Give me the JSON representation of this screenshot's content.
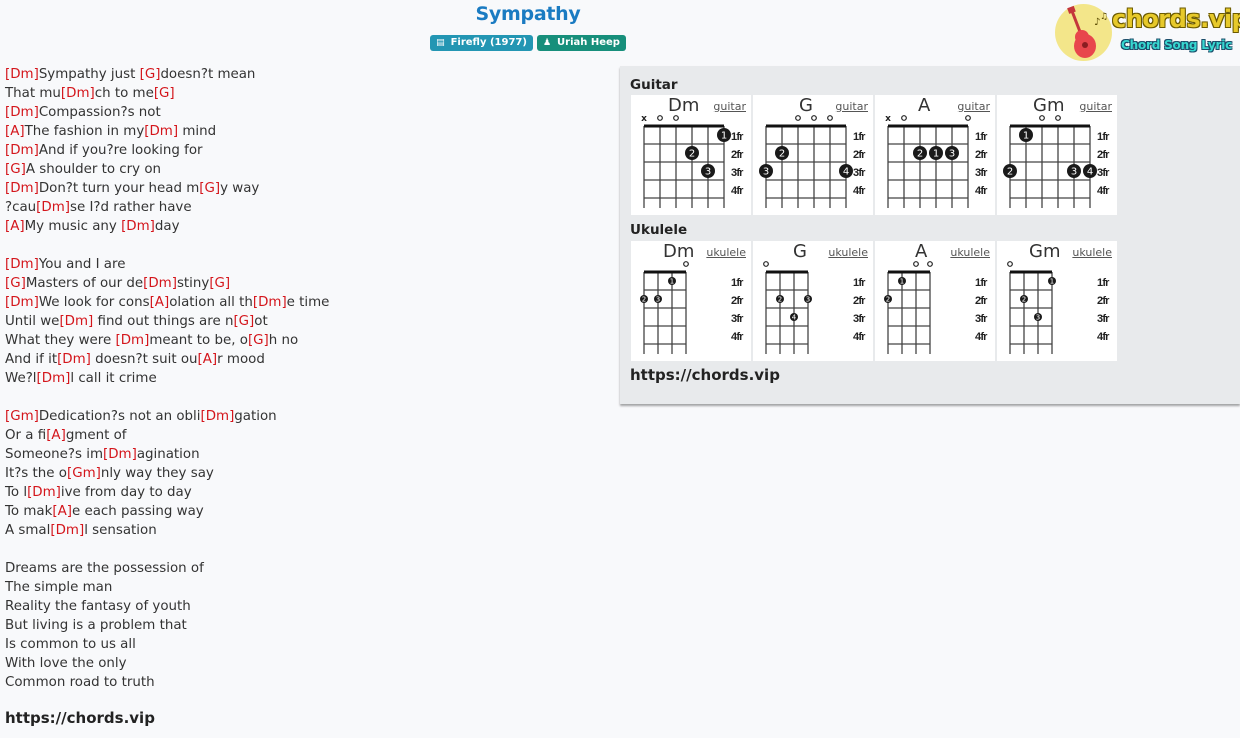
{
  "song": {
    "title": "Sympathy",
    "album": "Firefly (1977)",
    "album_icon": "book-icon",
    "artist": "Uriah Heep",
    "artist_icon": "user-icon"
  },
  "logo": {
    "name": "chords.vip",
    "tagline": "Chord Song Lyric",
    "icon": "guitar-icon"
  },
  "colors": {
    "title": "#1a7bc2",
    "chord": "#d4151b",
    "album_tag": "#2396b3",
    "artist_tag": "#178f7b"
  },
  "lyrics": [
    [
      {
        "c": "Dm"
      },
      {
        "t": "Sympathy just "
      },
      {
        "c": "G"
      },
      {
        "t": "doesn?t mean"
      }
    ],
    [
      {
        "t": "That mu"
      },
      {
        "c": "Dm"
      },
      {
        "t": "ch to me"
      },
      {
        "c": "G"
      }
    ],
    [
      {
        "c": "Dm"
      },
      {
        "t": "Compassion?s not"
      }
    ],
    [
      {
        "c": "A"
      },
      {
        "t": "The fashion in my"
      },
      {
        "c": "Dm"
      },
      {
        "t": " mind"
      }
    ],
    [
      {
        "c": "Dm"
      },
      {
        "t": "And if you?re looking for"
      }
    ],
    [
      {
        "c": "G"
      },
      {
        "t": "A shoulder to cry on"
      }
    ],
    [
      {
        "c": "Dm"
      },
      {
        "t": "Don?t turn your head m"
      },
      {
        "c": "G"
      },
      {
        "t": "y way"
      }
    ],
    [
      {
        "t": "?cau"
      },
      {
        "c": "Dm"
      },
      {
        "t": "se I?d rather have"
      }
    ],
    [
      {
        "c": "A"
      },
      {
        "t": "My music any "
      },
      {
        "c": "Dm"
      },
      {
        "t": "day"
      }
    ],
    [],
    [
      {
        "c": "Dm"
      },
      {
        "t": "You and I are"
      }
    ],
    [
      {
        "c": "G"
      },
      {
        "t": "Masters of our de"
      },
      {
        "c": "Dm"
      },
      {
        "t": "stiny"
      },
      {
        "c": "G"
      }
    ],
    [
      {
        "c": "Dm"
      },
      {
        "t": "We look for cons"
      },
      {
        "c": "A"
      },
      {
        "t": "olation all th"
      },
      {
        "c": "Dm"
      },
      {
        "t": "e time"
      }
    ],
    [
      {
        "t": "Until we"
      },
      {
        "c": "Dm"
      },
      {
        "t": " find out things are n"
      },
      {
        "c": "G"
      },
      {
        "t": "ot"
      }
    ],
    [
      {
        "t": "What they were "
      },
      {
        "c": "Dm"
      },
      {
        "t": "meant to be, o"
      },
      {
        "c": "G"
      },
      {
        "t": "h no"
      }
    ],
    [
      {
        "t": "And if it"
      },
      {
        "c": "Dm"
      },
      {
        "t": " doesn?t suit ou"
      },
      {
        "c": "A"
      },
      {
        "t": "r mood"
      }
    ],
    [
      {
        "t": "We?l"
      },
      {
        "c": "Dm"
      },
      {
        "t": "l call it crime"
      }
    ],
    [],
    [
      {
        "c": "Gm"
      },
      {
        "t": "Dedication?s not an obli"
      },
      {
        "c": "Dm"
      },
      {
        "t": "gation"
      }
    ],
    [
      {
        "t": "Or a fi"
      },
      {
        "c": "A"
      },
      {
        "t": "gment of"
      }
    ],
    [
      {
        "t": "Someone?s im"
      },
      {
        "c": "Dm"
      },
      {
        "t": "agination"
      }
    ],
    [
      {
        "t": "It?s the o"
      },
      {
        "c": "Gm"
      },
      {
        "t": "nly way they say"
      }
    ],
    [
      {
        "t": "To l"
      },
      {
        "c": "Dm"
      },
      {
        "t": "ive from day to day"
      }
    ],
    [
      {
        "t": "To mak"
      },
      {
        "c": "A"
      },
      {
        "t": "e each passing way"
      }
    ],
    [
      {
        "t": "A smal"
      },
      {
        "c": "Dm"
      },
      {
        "t": "l sensation"
      }
    ],
    [],
    [
      {
        "t": "Dreams are the possession of"
      }
    ],
    [
      {
        "t": "The simple man"
      }
    ],
    [
      {
        "t": "Reality the fantasy of youth"
      }
    ],
    [
      {
        "t": "But living is a problem that"
      }
    ],
    [
      {
        "t": "Is common to us all"
      }
    ],
    [
      {
        "t": "With love the only"
      }
    ],
    [
      {
        "t": "Common road to truth"
      }
    ]
  ],
  "footer_url": "https://chords.vip",
  "chord_panel": {
    "url": "https://chords.vip",
    "fret_labels": [
      "1fr",
      "2fr",
      "3fr",
      "4fr"
    ],
    "guitar": {
      "heading": "Guitar",
      "link_label": "guitar",
      "chords": [
        {
          "name": "Dm",
          "markers": [
            "x",
            "o",
            "o",
            "",
            "",
            ""
          ],
          "dots": [
            {
              "s": 6,
              "f": 1,
              "n": "1"
            },
            {
              "s": 4,
              "f": 2,
              "n": "2"
            },
            {
              "s": 5,
              "f": 3,
              "n": "3"
            }
          ]
        },
        {
          "name": "G",
          "markers": [
            "",
            "",
            "o",
            "o",
            "o",
            ""
          ],
          "dots": [
            {
              "s": 2,
              "f": 2,
              "n": "2"
            },
            {
              "s": 1,
              "f": 3,
              "n": "3"
            },
            {
              "s": 6,
              "f": 3,
              "n": "4"
            }
          ]
        },
        {
          "name": "A",
          "markers": [
            "x",
            "o",
            "",
            "",
            "",
            "o"
          ],
          "dots": [
            {
              "s": 3,
              "f": 2,
              "n": "2"
            },
            {
              "s": 4,
              "f": 2,
              "n": "1"
            },
            {
              "s": 5,
              "f": 2,
              "n": "3"
            }
          ]
        },
        {
          "name": "Gm",
          "markers": [
            "",
            "",
            "o",
            "o",
            "",
            ""
          ],
          "dots": [
            {
              "s": 2,
              "f": 1,
              "n": "1"
            },
            {
              "s": 1,
              "f": 3,
              "n": "2"
            },
            {
              "s": 5,
              "f": 3,
              "n": "3"
            },
            {
              "s": 6,
              "f": 3,
              "n": "4"
            }
          ]
        }
      ]
    },
    "ukulele": {
      "heading": "Ukulele",
      "link_label": "ukulele",
      "chords": [
        {
          "name": "Dm",
          "markers": [
            "",
            "",
            "",
            "o"
          ],
          "dots": [
            {
              "s": 3,
              "f": 1,
              "n": "1"
            },
            {
              "s": 1,
              "f": 2,
              "n": "2"
            },
            {
              "s": 2,
              "f": 2,
              "n": "3"
            }
          ]
        },
        {
          "name": "G",
          "markers": [
            "o",
            "",
            "",
            ""
          ],
          "dots": [
            {
              "s": 2,
              "f": 2,
              "n": "2"
            },
            {
              "s": 4,
              "f": 2,
              "n": "3"
            },
            {
              "s": 3,
              "f": 3,
              "n": "4"
            }
          ]
        },
        {
          "name": "A",
          "markers": [
            "",
            "",
            "o",
            "o"
          ],
          "dots": [
            {
              "s": 2,
              "f": 1,
              "n": "1"
            },
            {
              "s": 1,
              "f": 2,
              "n": "2"
            }
          ]
        },
        {
          "name": "Gm",
          "markers": [
            "o",
            "",
            "",
            ""
          ],
          "dots": [
            {
              "s": 4,
              "f": 1,
              "n": "1"
            },
            {
              "s": 2,
              "f": 2,
              "n": "2"
            },
            {
              "s": 3,
              "f": 3,
              "n": "3"
            }
          ]
        }
      ]
    }
  }
}
